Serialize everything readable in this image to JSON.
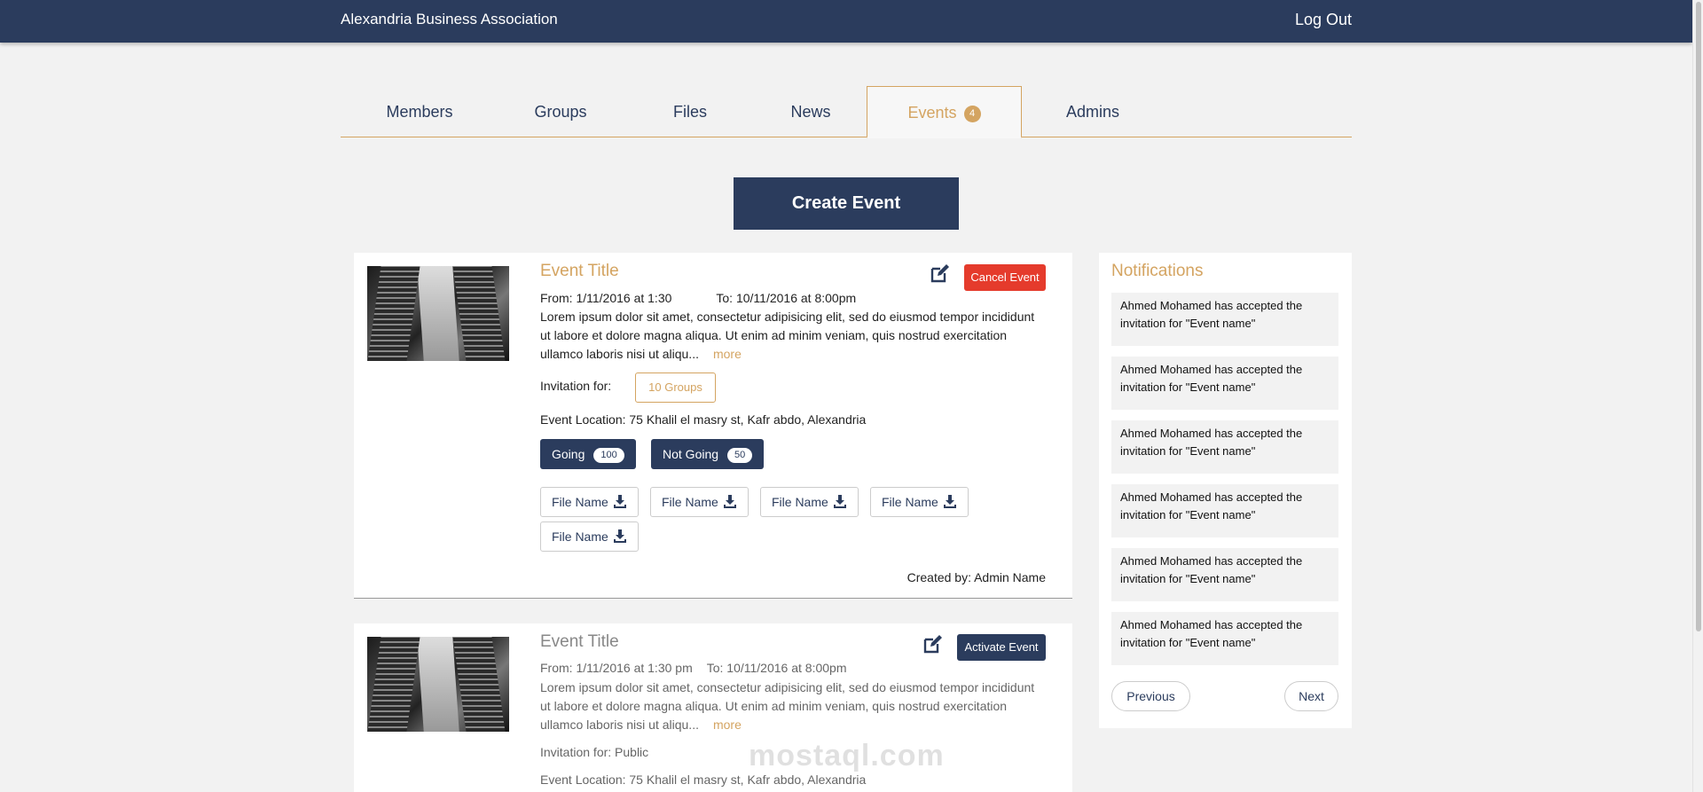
{
  "header": {
    "brand": "Alexandria Business Association",
    "logout": "Log Out"
  },
  "tabs": [
    {
      "label": "Members"
    },
    {
      "label": "Groups"
    },
    {
      "label": "Files"
    },
    {
      "label": "News"
    },
    {
      "label": "Events",
      "badge": "4",
      "active": true
    },
    {
      "label": "Admins"
    }
  ],
  "create_event": "Create Event",
  "events": [
    {
      "title": "Event Title",
      "from": "From: 1/11/2016 at 1:30",
      "to": "To: 10/11/2016 at 8:00pm",
      "description": "Lorem ipsum dolor sit amet, consectetur adipisicing elit, sed do eiusmod tempor incididunt ut labore et dolore magna aliqua. Ut enim ad minim veniam, quis nostrud exercitation ullamco laboris nisi ut aliqu...",
      "more": "more",
      "action": "Cancel Event",
      "invitation_label": "Invitation for:",
      "invitation_value": "10 Groups",
      "location": "Event Location: 75 Khalil el masry st, Kafr abdo, Alexandria",
      "going_label": "Going",
      "going_count": "100",
      "not_going_label": "Not Going",
      "not_going_count": "50",
      "files": [
        "File Name",
        "File Name",
        "File Name",
        "File Name",
        "File Name"
      ],
      "created_by": "Created by: Admin Name"
    },
    {
      "title": "Event Title",
      "from": "From: 1/11/2016 at 1:30 pm",
      "to": "To: 10/11/2016 at 8:00pm",
      "description": "Lorem ipsum dolor sit amet, consectetur adipisicing elit, sed do eiusmod tempor incididunt ut labore et dolore magna aliqua. Ut enim ad minim veniam, quis nostrud exercitation ullamco laboris nisi ut aliqu...",
      "more": "more",
      "action": "Activate Event",
      "invitation": "Invitation for: Public",
      "location": "Event Location: 75 Khalil el masry st, Kafr abdo, Alexandria"
    }
  ],
  "notifications": {
    "title": "Notifications",
    "items": [
      "Ahmed Mohamed has accepted the invitation for \"Event name\"",
      "Ahmed Mohamed has accepted the invitation for \"Event name\"",
      "Ahmed Mohamed has accepted the invitation for \"Event name\"",
      "Ahmed Mohamed has accepted the invitation for \"Event name\"",
      "Ahmed Mohamed has accepted the invitation for \"Event name\"",
      "Ahmed Mohamed has accepted the invitation for \"Event name\""
    ],
    "previous": "Previous",
    "next": "Next"
  },
  "watermark": "mostaql.com",
  "colors": {
    "navy": "#2b3c5d",
    "gold": "#d4a461",
    "red": "#e53b2c"
  }
}
